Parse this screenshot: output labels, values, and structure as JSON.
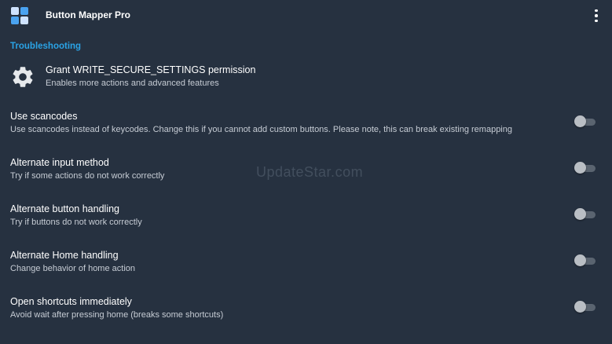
{
  "app": {
    "title": "Button Mapper Pro"
  },
  "section": {
    "title": "Troubleshooting"
  },
  "permission": {
    "title": "Grant WRITE_SECURE_SETTINGS permission",
    "subtitle": "Enables more actions and advanced features"
  },
  "prefs": [
    {
      "title": "Use scancodes",
      "subtitle": "Use scancodes instead of keycodes. Change this if you cannot add custom buttons. Please note, this can break existing remapping",
      "enabled": false
    },
    {
      "title": "Alternate input method",
      "subtitle": "Try if some actions do not work correctly",
      "enabled": false
    },
    {
      "title": "Alternate button handling",
      "subtitle": "Try if buttons do not work correctly",
      "enabled": false
    },
    {
      "title": "Alternate Home handling",
      "subtitle": "Change behavior of home action",
      "enabled": false
    },
    {
      "title": "Open shortcuts immediately",
      "subtitle": "Avoid wait after pressing home (breaks some shortcuts)",
      "enabled": false
    }
  ],
  "watermark": "UpdateStar.com",
  "icons": {
    "app": "app-grid-icon",
    "overflow": "more-vert-icon",
    "permission": "gear-icon"
  },
  "colors": {
    "background": "#263140",
    "accent": "#2aa3e6",
    "switch_off_track": "#5a6470",
    "switch_off_thumb": "#b9bec4"
  }
}
